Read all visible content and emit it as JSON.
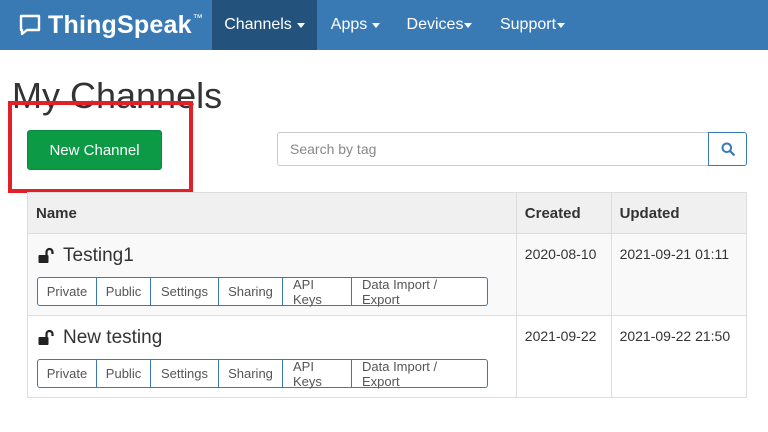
{
  "brand": {
    "name": "ThingSpeak",
    "trademark": "™"
  },
  "nav": {
    "items": [
      {
        "label": "Channels",
        "active": true
      },
      {
        "label": "Apps",
        "active": false
      },
      {
        "label": "Devices",
        "active": false
      },
      {
        "label": "Support",
        "active": false
      }
    ]
  },
  "page": {
    "title": "My Channels"
  },
  "actions": {
    "new_channel_label": "New Channel"
  },
  "search": {
    "placeholder": "Search by tag",
    "value": ""
  },
  "table": {
    "headers": {
      "name": "Name",
      "created": "Created",
      "updated": "Updated"
    },
    "rows": [
      {
        "name": "Testing1",
        "created": "2020-08-10",
        "updated": "2021-09-21 01:11",
        "buttons": [
          "Private",
          "Public",
          "Settings",
          "Sharing",
          "API Keys",
          "Data Import / Export"
        ]
      },
      {
        "name": "New testing",
        "created": "2021-09-22",
        "updated": "2021-09-22 21:50",
        "buttons": [
          "Private",
          "Public",
          "Settings",
          "Sharing",
          "API Keys",
          "Data Import / Export"
        ]
      }
    ]
  },
  "colors": {
    "navbar": "#3a7ab4",
    "nav_active": "#23527c",
    "new_channel_button": "#0c9a46",
    "highlight_box": "#e32027",
    "button_border": "#3a7ab4"
  }
}
